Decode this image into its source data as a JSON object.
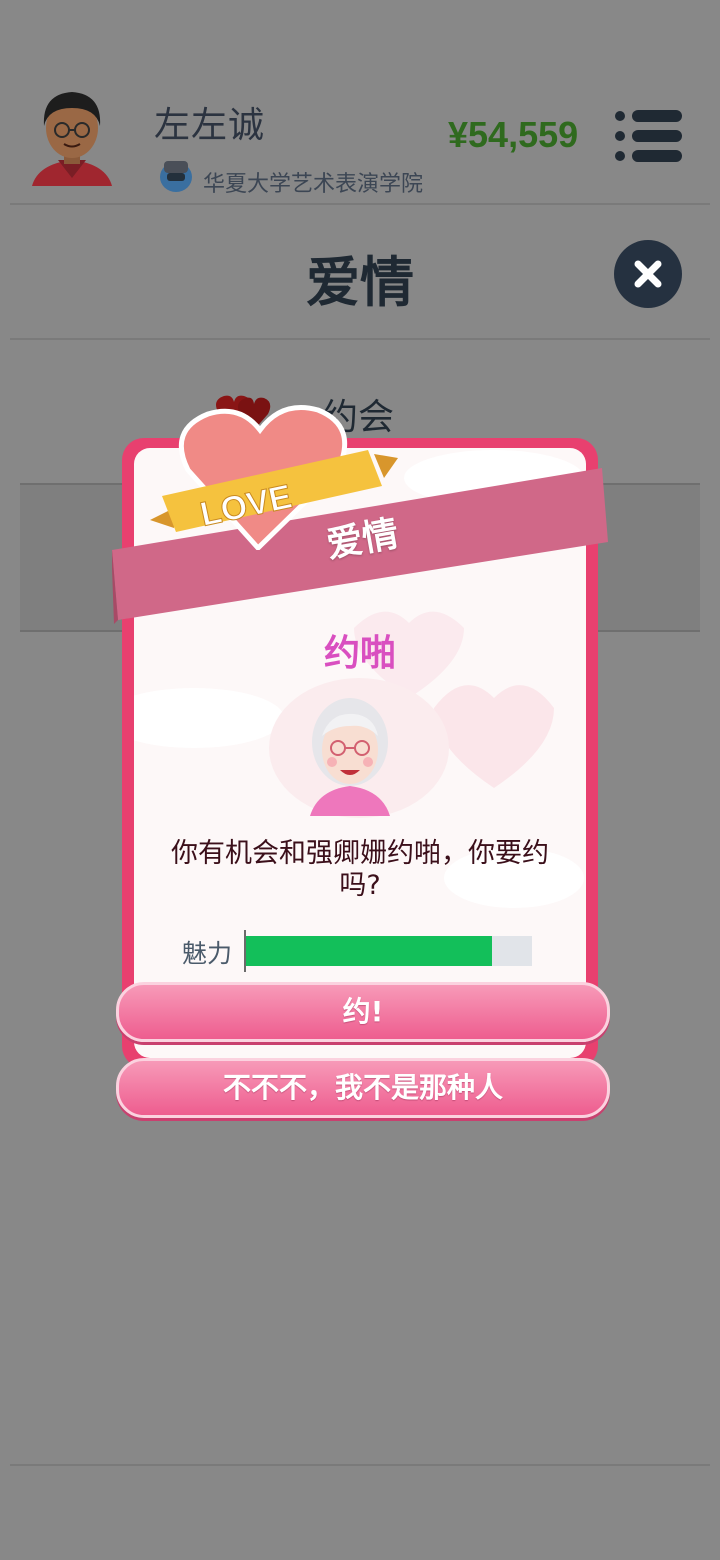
{
  "header": {
    "player_name": "左左诚",
    "school": "华夏大学艺术表演学院",
    "money": "¥54,559",
    "menu_icon": "menu-list-icon",
    "avatar_icon": "player-avatar-icon",
    "school_icon": "helmet-icon"
  },
  "page": {
    "title": "爱情",
    "close_icon": "close-icon",
    "tab_label": "约会",
    "tab_icon": "hearts-icon"
  },
  "modal": {
    "ribbon_title": "爱情",
    "badge_text": "LOVE",
    "event_title": "约啪",
    "event_text": "你有机会和强卿姗约啪，你要约吗?",
    "stat": {
      "label": "魅力",
      "value": 0.86,
      "color": "#13bf5a"
    },
    "accept_label": "约!",
    "decline_label": "不不不，我不是那种人",
    "colors": {
      "frame": "#e8406f",
      "ribbon": "#d06888",
      "title": "#d94fc0"
    }
  }
}
